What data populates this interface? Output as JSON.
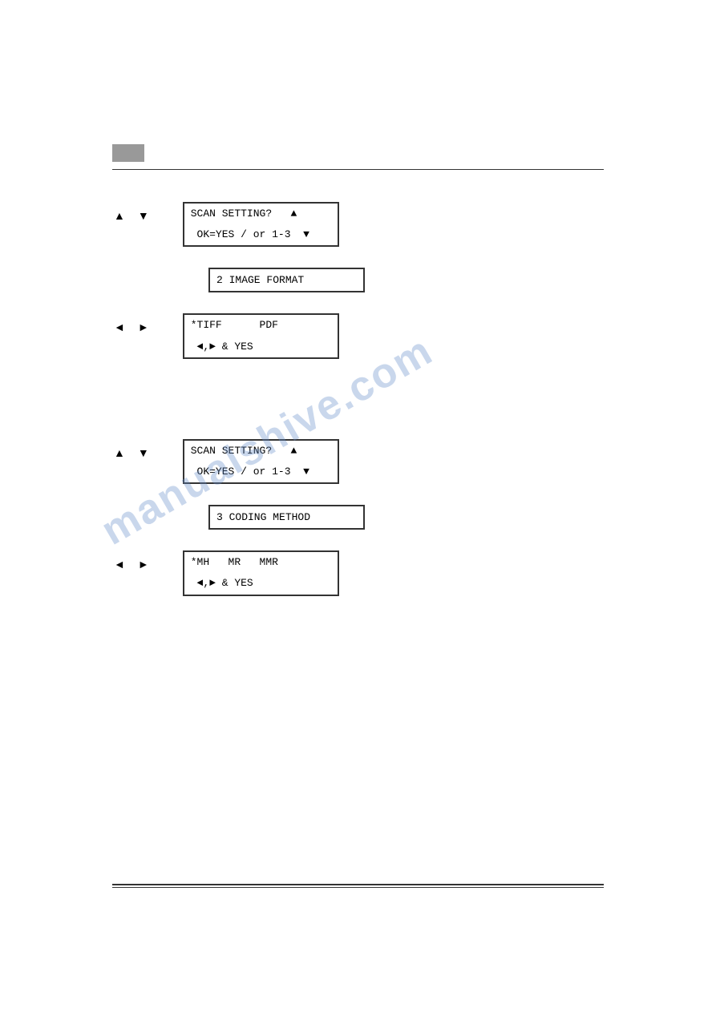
{
  "page": {
    "watermark": "manualshive.com"
  },
  "topBar": {
    "grayBox": "",
    "rule": ""
  },
  "section1": {
    "upArrow": "▲",
    "downArrow": "▼",
    "display1_line1": "SCAN SETTING?   ▲",
    "display1_line2": " OK=YES / or 1-3  ▼",
    "display2": "2 IMAGE FORMAT",
    "leftArrow": "◄",
    "rightArrow": "►",
    "display3_line1": "*TIFF      PDF",
    "display3_line2": " ◄,► & YES"
  },
  "section2": {
    "upArrow": "▲",
    "downArrow": "▼",
    "display1_line1": "SCAN SETTING?   ▲",
    "display1_line2": " OK=YES / or 1-3  ▼",
    "display2": "3 CODING METHOD",
    "leftArrow": "◄",
    "rightArrow": "►",
    "display3_line1": "*MH   MR   MMR",
    "display3_line2": " ◄,► & YES"
  }
}
